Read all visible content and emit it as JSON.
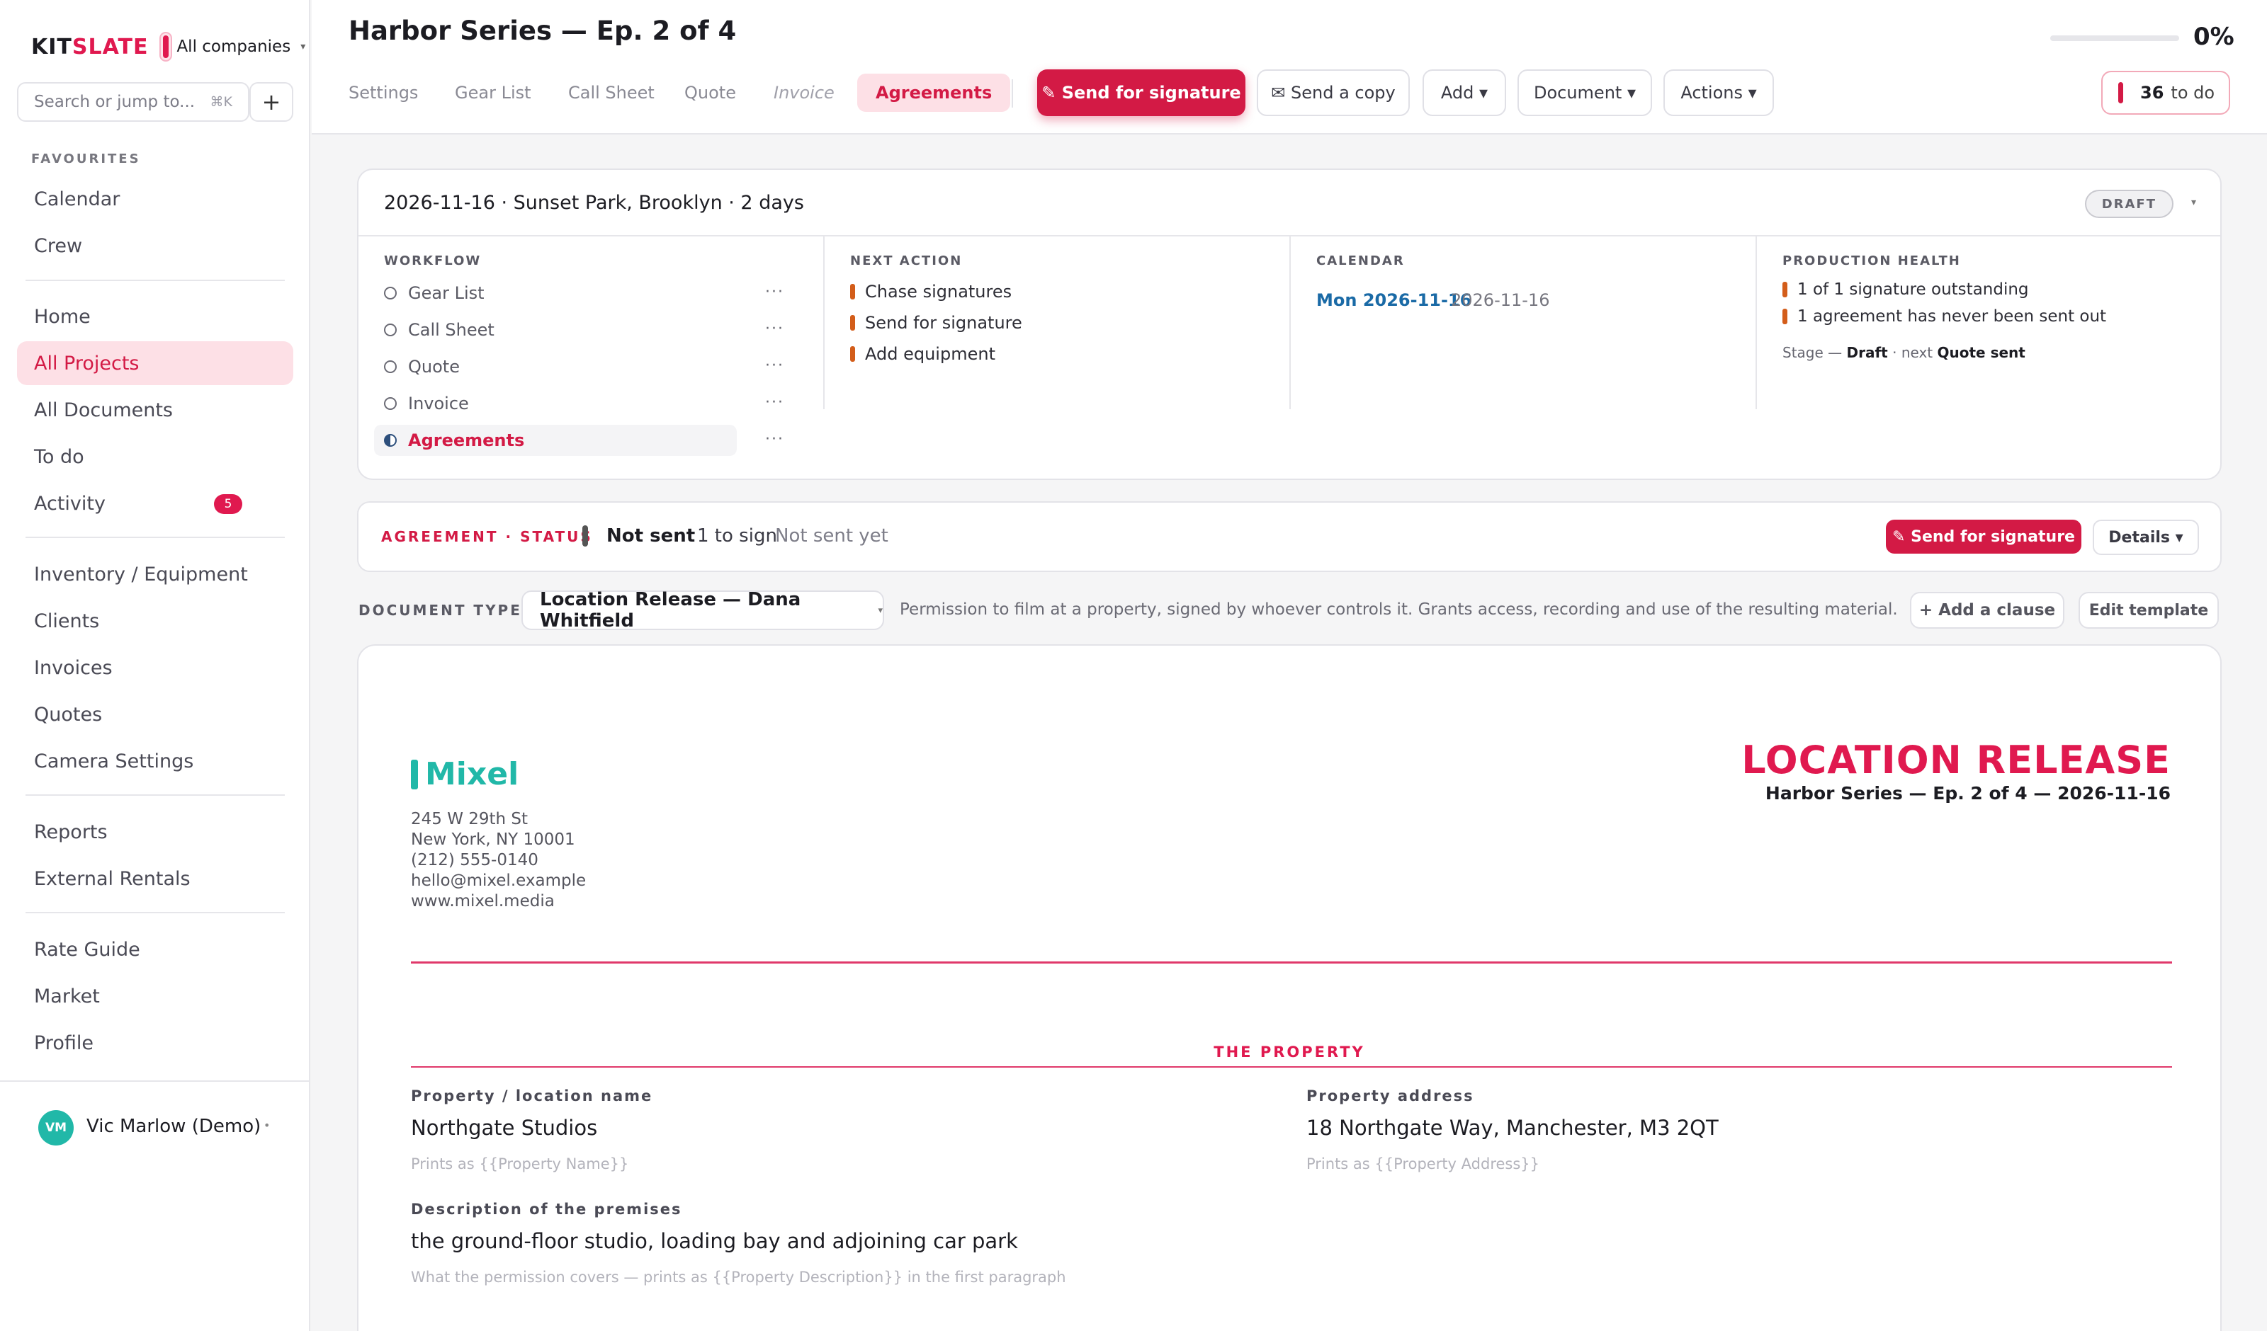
{
  "sidebar": {
    "brand_kit": "KIT",
    "brand_slate": "SLATE",
    "company": "All companies",
    "search_placeholder": "Search or jump to...",
    "search_shortcut": "⌘K",
    "favourites_label": "FAVOURITES",
    "fav_items": [
      "Calendar",
      "Crew"
    ],
    "main_items": [
      "Home",
      "All Projects",
      "All Documents",
      "To do",
      "Activity"
    ],
    "activity_badge": "5",
    "mgmt_items": [
      "Inventory / Equipment",
      "Clients",
      "Invoices",
      "Quotes",
      "Camera Settings"
    ],
    "report_items": [
      "Reports",
      "External Rentals"
    ],
    "other_items": [
      "Rate Guide",
      "Market",
      "Profile"
    ],
    "user_initials": "VM",
    "user_name": "Vic Marlow (Demo)"
  },
  "header": {
    "title": "Harbor Series — Ep. 2 of 4",
    "progress_pct": "0%",
    "progress_value": 0,
    "tabs": [
      "Settings",
      "Gear List",
      "Call Sheet",
      "Quote",
      "Invoice",
      "Agreements"
    ],
    "send_signature": "✎ Send for signature",
    "send_copy": "✉ Send a copy",
    "add": "Add ▾",
    "document": "Document ▾",
    "actions": "Actions ▾",
    "todo_count": "36",
    "todo_label": "to do"
  },
  "overview": {
    "summary": "2026-11-16 · Sunset Park, Brooklyn · 2 days",
    "status": "DRAFT",
    "workflow_label": "WORKFLOW",
    "workflow": [
      "Gear List",
      "Call Sheet",
      "Quote",
      "Invoice",
      "Agreements"
    ],
    "next_action_label": "NEXT ACTION",
    "next_actions": [
      "Chase signatures",
      "Send for signature",
      "Add equipment"
    ],
    "calendar_label": "CALENDAR",
    "calendar_day": "Mon 2026-11-16",
    "calendar_date": "2026-11-16",
    "health_label": "PRODUCTION HEALTH",
    "health": [
      "1 of 1 signature outstanding",
      "1 agreement has never been sent out"
    ],
    "stage_prefix": "Stage — ",
    "stage_current": "Draft",
    "stage_next_prefix": " · next ",
    "stage_next": "Quote sent"
  },
  "agreement": {
    "label": "AGREEMENT · STATUS",
    "status": "Not sent",
    "to_sign": "1 to sign",
    "sent_note": "Not sent yet",
    "send_button": "✎ Send for signature",
    "details_button": "Details ▾"
  },
  "doctype": {
    "label": "DOCUMENT TYPE",
    "selected": "Location Release — Dana Whitfield",
    "description": "Permission to film at a property, signed by whoever controls it. Grants access, recording and use of the resulting material.",
    "add_clause": "+ Add a clause",
    "edit_template": "Edit template"
  },
  "document": {
    "logo_text": "Mixel",
    "address_lines": [
      "245 W 29th St",
      "New York, NY 10001",
      "(212) 555-0140",
      "hello@mixel.example",
      "www.mixel.media"
    ],
    "title": "LOCATION RELEASE",
    "subtitle": "Harbor Series — Ep. 2 of 4 — 2026-11-16",
    "section_title": "THE PROPERTY",
    "fields": {
      "name_label": "Property / location name",
      "name_value": "Northgate Studios",
      "name_hint": "Prints as {{Property Name}}",
      "address_label": "Property address",
      "address_value": "18 Northgate Way, Manchester, M3 2QT",
      "address_hint": "Prints as {{Property Address}}",
      "desc_label": "Description of the premises",
      "desc_value": "the ground-floor studio, loading bay and adjoining car park",
      "desc_hint": "What the permission covers — prints as {{Property Description}} in the first paragraph"
    }
  },
  "colors": {
    "accent": "#e0194f",
    "teal": "#21b8a8",
    "warning": "#d35d1a"
  }
}
